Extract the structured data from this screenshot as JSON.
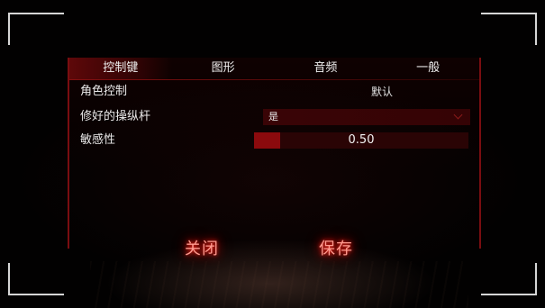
{
  "tabs": [
    {
      "label": "控制键",
      "active": true
    },
    {
      "label": "图形",
      "active": false
    },
    {
      "label": "音频",
      "active": false
    },
    {
      "label": "一般",
      "active": false
    }
  ],
  "settings": {
    "character_control": {
      "label": "角色控制",
      "button": "默认"
    },
    "fixed_joystick": {
      "label": "修好的操纵杆",
      "value": "是"
    },
    "sensitivity": {
      "label": "敏感性",
      "value": "0.50",
      "fraction": 0.12
    }
  },
  "buttons": {
    "close": "关闭",
    "save": "保存"
  },
  "colors": {
    "accent": "#8b0a0d",
    "glow": "#ff2a1a",
    "panel_border": "#7a0d10"
  }
}
